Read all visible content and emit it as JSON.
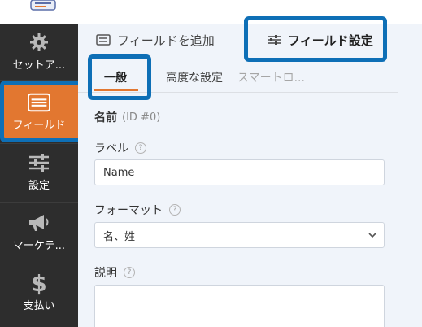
{
  "sidebar": {
    "items": [
      {
        "label": "セットア...",
        "icon": "gear-icon"
      },
      {
        "label": "フィールド",
        "icon": "fields-list-icon"
      },
      {
        "label": "設定",
        "icon": "sliders-icon"
      },
      {
        "label": "マーケテ...",
        "icon": "megaphone-icon"
      },
      {
        "label": "支払い",
        "icon": "dollar-icon"
      }
    ],
    "active_color": "#e27730"
  },
  "tabs": {
    "add_fields": "フィールドを追加",
    "field_settings": "フィールド設定"
  },
  "subtabs": {
    "general": "一般",
    "advanced": "高度な設定",
    "smart": "スマートロ..."
  },
  "form": {
    "name_title": "名前",
    "name_id": "(ID #0)",
    "label_caption": "ラベル",
    "label_value": "Name",
    "format_caption": "フォーマット",
    "format_value": "名、姓",
    "description_caption": "説明"
  },
  "colors": {
    "highlight": "#0e6fb6",
    "accent": "#e27730",
    "sidebar_bg": "#2d2d2d",
    "panel_bg": "#f0f4fa"
  }
}
